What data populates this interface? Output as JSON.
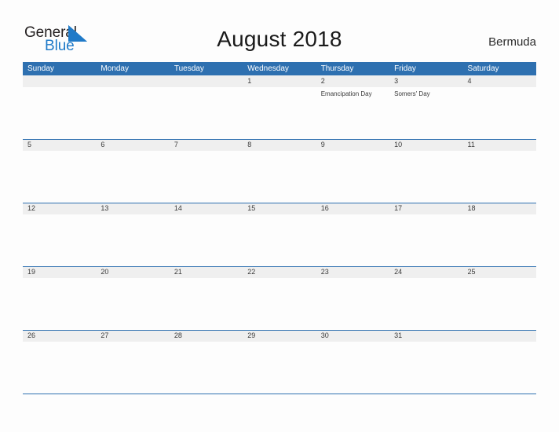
{
  "brand": {
    "name_part1": "General",
    "name_part2": "Blue",
    "triangle_icon": "blue-triangle-icon",
    "color_dark": "#231f20",
    "color_blue": "#1f7ac8"
  },
  "header": {
    "title": "August 2018",
    "region": "Bermuda"
  },
  "theme": {
    "header_blue": "#2e70b0",
    "band_gray": "#efefef",
    "page_background": "#fdfdfd",
    "text_color": "#3a3a3a"
  },
  "calendar": {
    "weekdays": [
      "Sunday",
      "Monday",
      "Tuesday",
      "Wednesday",
      "Thursday",
      "Friday",
      "Saturday"
    ],
    "weeks": [
      [
        {
          "day": "",
          "events": []
        },
        {
          "day": "",
          "events": []
        },
        {
          "day": "",
          "events": []
        },
        {
          "day": "1",
          "events": []
        },
        {
          "day": "2",
          "events": [
            "Emancipation Day"
          ]
        },
        {
          "day": "3",
          "events": [
            "Somers' Day"
          ]
        },
        {
          "day": "4",
          "events": []
        }
      ],
      [
        {
          "day": "5",
          "events": []
        },
        {
          "day": "6",
          "events": []
        },
        {
          "day": "7",
          "events": []
        },
        {
          "day": "8",
          "events": []
        },
        {
          "day": "9",
          "events": []
        },
        {
          "day": "10",
          "events": []
        },
        {
          "day": "11",
          "events": []
        }
      ],
      [
        {
          "day": "12",
          "events": []
        },
        {
          "day": "13",
          "events": []
        },
        {
          "day": "14",
          "events": []
        },
        {
          "day": "15",
          "events": []
        },
        {
          "day": "16",
          "events": []
        },
        {
          "day": "17",
          "events": []
        },
        {
          "day": "18",
          "events": []
        }
      ],
      [
        {
          "day": "19",
          "events": []
        },
        {
          "day": "20",
          "events": []
        },
        {
          "day": "21",
          "events": []
        },
        {
          "day": "22",
          "events": []
        },
        {
          "day": "23",
          "events": []
        },
        {
          "day": "24",
          "events": []
        },
        {
          "day": "25",
          "events": []
        }
      ],
      [
        {
          "day": "26",
          "events": []
        },
        {
          "day": "27",
          "events": []
        },
        {
          "day": "28",
          "events": []
        },
        {
          "day": "29",
          "events": []
        },
        {
          "day": "30",
          "events": []
        },
        {
          "day": "31",
          "events": []
        },
        {
          "day": "",
          "events": []
        }
      ]
    ]
  }
}
